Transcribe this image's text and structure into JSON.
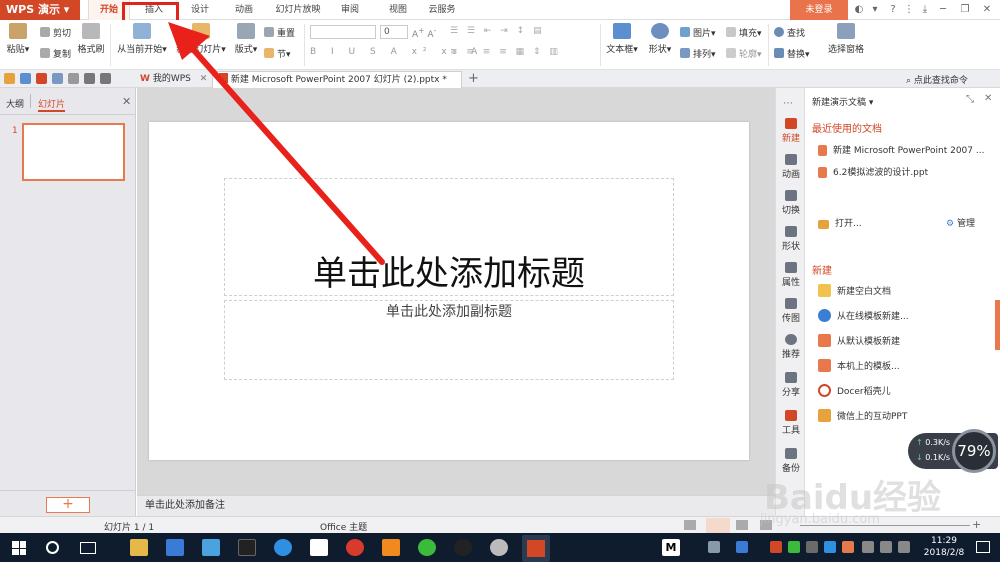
{
  "app": {
    "logo": "WPS 演示"
  },
  "menu": {
    "tabs": [
      "开始",
      "插入",
      "设计",
      "动画",
      "幻灯片放映",
      "审阅",
      "视图",
      "云服务"
    ],
    "active": "开始",
    "login": "未登录"
  },
  "ribbon": {
    "paste": "粘贴",
    "cut": "剪切",
    "copy": "复制",
    "format_painter": "格式刷",
    "from_current": "从当前开始",
    "new_slide": "新建幻灯片",
    "layout": "版式",
    "section": "节",
    "reset": "重置",
    "font_size": "0",
    "text_box": "文本框",
    "shape": "形状",
    "picture": "图片",
    "fill": "填充",
    "arrange": "排列",
    "outline": "轮廓",
    "find": "查找",
    "replace": "替换",
    "selection_pane": "选择窗格"
  },
  "docbar": {
    "tab_home": "我的WPS",
    "tab_doc": "新建 Microsoft PowerPoint 2007 幻灯片 (2).pptx *",
    "search": "点此查找命令"
  },
  "leftpanel": {
    "tab_outline": "大纲",
    "tab_slides": "幻灯片",
    "slide_number": "1",
    "add_label": "+"
  },
  "slide": {
    "title": "单击此处添加标题",
    "subtitle": "单击此处添加副标题"
  },
  "notes": "单击此处添加备注",
  "sidebar": {
    "items": [
      "新建",
      "动画",
      "切换",
      "形状",
      "属性",
      "传图",
      "推荐",
      "分享",
      "工具",
      "备份"
    ]
  },
  "taskpane": {
    "header": "新建演示文稿",
    "recent_title": "最近使用的文档",
    "recent": [
      "新建 Microsoft PowerPoint 2007 ...",
      "6.2模拟滤波的设计.ppt"
    ],
    "open": "打开...",
    "manage": "管理",
    "new_title": "新建",
    "new_items": [
      "新建空白文档",
      "从在线模板新建...",
      "从默认模板新建",
      "本机上的模板...",
      "Docer稻壳儿",
      "微信上的互动PPT"
    ]
  },
  "status": {
    "slide_count": "幻灯片 1 / 1",
    "theme": "Office 主题"
  },
  "net": {
    "up": "0.3K/s",
    "down": "0.1K/s",
    "percent": "79%"
  },
  "taskbar": {
    "time": "11:29",
    "date": "2018/2/8"
  },
  "watermark": {
    "text": "Baidu经验",
    "url": "jingyan.baidu.com"
  },
  "colors": {
    "accent": "#d24726",
    "highlight_box": "#e0241b",
    "arrow": "#e8211b"
  }
}
